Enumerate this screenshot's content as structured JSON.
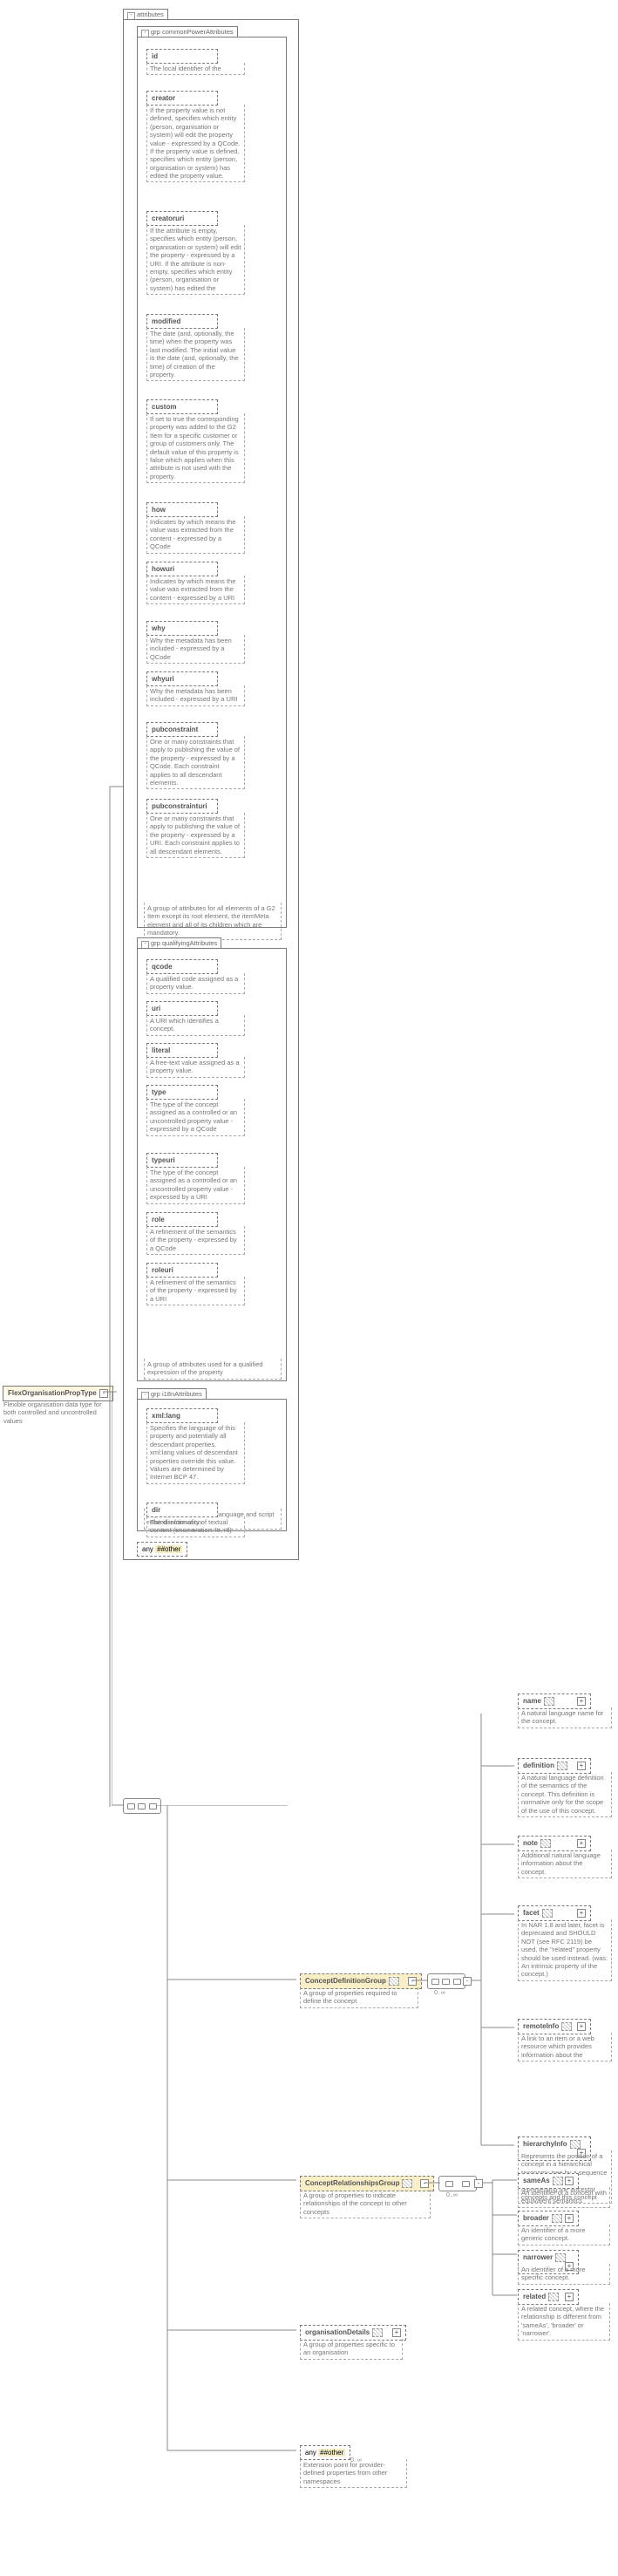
{
  "root": {
    "name": "FlexOrganisationPropType",
    "desc": "Flexible organisation data type for both controlled and uncontrolled values"
  },
  "tabs": {
    "attributes": "attributes",
    "commonPower": "commonPowerAttributes",
    "qualifying": "qualifyingAttributes",
    "i18n": "i18nAttributes",
    "grp": "grp"
  },
  "groups": {
    "commonPower": {
      "note": "A group of attributes for all elements of a G2 Item except its root element, the itemMeta element and all of its children which are mandatory."
    },
    "qualifying": {
      "note": "A group of attributes used for a qualified expression of the property"
    },
    "i18n": {
      "note": "A group of attributes for language and script related information"
    }
  },
  "attrs": {
    "id": {
      "name": "id",
      "desc": "The local identifier of the"
    },
    "creator": {
      "name": "creator",
      "desc": "If the property value is not defined, specifies which entity (person, organisation or system) will edit the property value - expressed by a QCode. If the property value is defined, specifies which entity (person, organisation or system) has edited the property value."
    },
    "creatoruri": {
      "name": "creatoruri",
      "desc": "If the attribute is empty, specifies which entity (person, organisation or system) will edit the property - expressed by a URI. If the attribute is non-empty, specifies which entity (person, organisation or system) has edited the"
    },
    "modified": {
      "name": "modified",
      "desc": "The date (and, optionally, the time) when the property was last modified. The initial value is the date (and, optionally, the time) of creation of the property."
    },
    "custom": {
      "name": "custom",
      "desc": "If set to true the corresponding property was added to the G2 Item for a specific customer or group of customers only. The default value of this property is false which applies when this attribute is not used with the property."
    },
    "how": {
      "name": "how",
      "desc": "Indicates by which means the value was extracted from the content - expressed by a QCode"
    },
    "howuri": {
      "name": "howuri",
      "desc": "Indicates by which means the value was extracted from the content - expressed by a URI"
    },
    "why": {
      "name": "why",
      "desc": "Why the metadata has been included - expressed by a QCode"
    },
    "whyuri": {
      "name": "whyuri",
      "desc": "Why the metadata has been included - expressed by a URI"
    },
    "pubconstraint": {
      "name": "pubconstraint",
      "desc": "One or many constraints that apply to publishing the value of the property - expressed by a QCode. Each constraint applies to all descendant elements."
    },
    "pubconstrainturi": {
      "name": "pubconstrainturi",
      "desc": "One or many constraints that apply to publishing the value of the property - expressed by a URI. Each constraint applies to all descendant elements."
    },
    "qcode": {
      "name": "qcode",
      "desc": "A qualified code assigned as a property value."
    },
    "uri": {
      "name": "uri",
      "desc": "A URI which identifies a concept."
    },
    "literal": {
      "name": "literal",
      "desc": "A free-text value assigned as a property value."
    },
    "type": {
      "name": "type",
      "desc": "The type of the concept assigned as a controlled or an uncontrolled property value - expressed by a QCode"
    },
    "typeuri": {
      "name": "typeuri",
      "desc": "The type of the concept assigned as a controlled or an uncontrolled property value - expressed by a URI"
    },
    "role": {
      "name": "role",
      "desc": "A refinement of the semantics of the property - expressed by a QCode"
    },
    "roleuri": {
      "name": "roleuri",
      "desc": "A refinement of the semantics of the property - expressed by a URI"
    },
    "xmllang": {
      "name": "xml:lang",
      "desc": "Specifies the language of this property and potentially all descendant properties. xml:lang values of descendant properties override this value. Values are determined by Internet BCP 47."
    },
    "dir": {
      "name": "dir",
      "desc": "The directionality of textual content (enumeration: ltr, rtl)"
    }
  },
  "any": {
    "name": "any",
    "kind": "##other"
  },
  "cdg": {
    "name": "ConceptDefinitionGroup",
    "desc": "A group of properties required to define the concept"
  },
  "crg": {
    "name": "ConceptRelationshipsGroup",
    "desc": "A group of properties to indicate relationships of the concept to other concepts"
  },
  "orgd": {
    "name": "organisationDetails",
    "desc": "A group of properties specific to an organisation"
  },
  "any2": {
    "name": "any",
    "kind": "##other",
    "desc": "Extension point for provider-defined properties from other namespaces"
  },
  "cdg_items": {
    "name": {
      "name": "name",
      "desc": "A natural language name for the concept."
    },
    "definition": {
      "name": "definition",
      "desc": "A natural language definition of the semantics of the concept. This definition is normative only for the scope of the use of this concept."
    },
    "note": {
      "name": "note",
      "desc": "Additional natural language information about the concept."
    },
    "facet": {
      "name": "facet",
      "desc": "In NAR 1.8 and later, facet is deprecated and SHOULD NOT (see RFC 2119) be used, the \"related\" property should be used instead. (was: An intrinsic property of the concept.)"
    },
    "remoteInfo": {
      "name": "remoteInfo",
      "desc": "A link to an item or a web resource which provides information about the"
    },
    "hierarchyInfo": {
      "name": "hierarchyInfo",
      "desc": "Represents the position of a concept in a hierarchical taxonomy tree by a sequence of QCode tokens representing the ancestor concepts and this concept"
    }
  },
  "crg_items": {
    "sameAs": {
      "name": "sameAs",
      "desc": "An identifier of a concept with equivalent semantics"
    },
    "broader": {
      "name": "broader",
      "desc": "An identifier of a more generic concept."
    },
    "narrower": {
      "name": "narrower",
      "desc": "An identifier of a more specific concept."
    },
    "related": {
      "name": "related",
      "desc": "A related concept, where the relationship is different from 'sameAs', 'broader' or 'narrower'."
    }
  },
  "mult": {
    "zi": "0..∞"
  }
}
